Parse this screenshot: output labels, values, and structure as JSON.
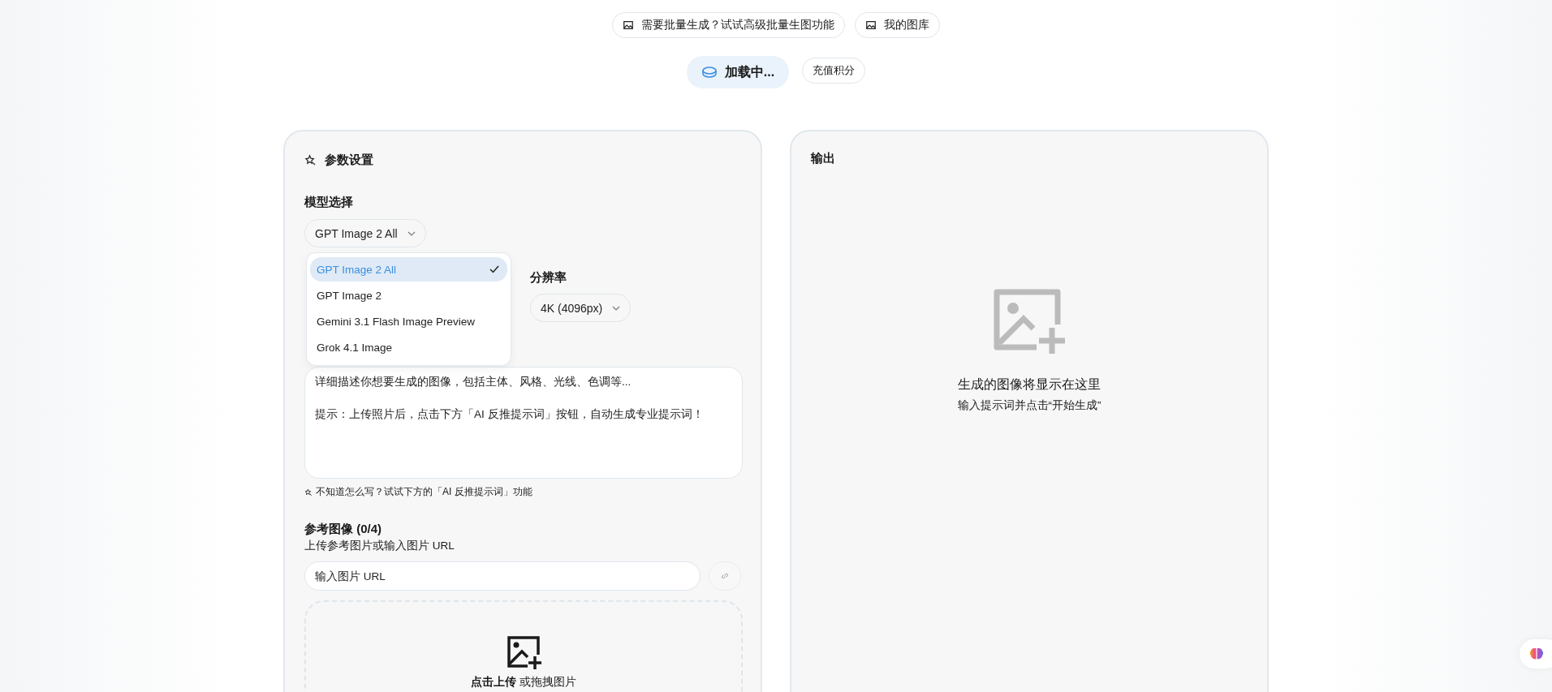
{
  "top_links": [
    {
      "label": "需要批量生成？试试高级批量生图功能"
    },
    {
      "label": "我的图库"
    }
  ],
  "credits": {
    "status": "加载中...",
    "recharge": "充值积分"
  },
  "params_panel": {
    "title": "参数设置",
    "model": {
      "label": "模型选择",
      "value": "GPT Image 2 All",
      "expanded": true,
      "options": [
        {
          "label": "GPT Image 2 All",
          "selected": true
        },
        {
          "label": "GPT Image 2",
          "selected": false
        },
        {
          "label": "Gemini 3.1 Flash Image Preview",
          "selected": false
        },
        {
          "label": "Grok 4.1 Image",
          "selected": false
        }
      ]
    },
    "resolution": {
      "label": "分辨率",
      "value": "4K (4096px)"
    },
    "prompt": {
      "placeholder": "详细描述你想要生成的图像，包括主体、风格、光线、色调等...\n\n提示：上传照片后，点击下方「AI 反推提示词」按钮，自动生成专业提示词！"
    },
    "hint": "不知道怎么写？试试下方的「AI 反推提示词」功能",
    "reference": {
      "title": "参考图像 (0/4)",
      "subtitle": "上传参考图片或输入图片 URL",
      "url_placeholder": "输入图片 URL",
      "dropzone": "**点击上传** 或拖拽图片"
    }
  },
  "output_panel": {
    "title": "输出",
    "empty_title": "生成的图像将显示在这里",
    "empty_hint": "输入提示词并点击“开始生成”"
  }
}
